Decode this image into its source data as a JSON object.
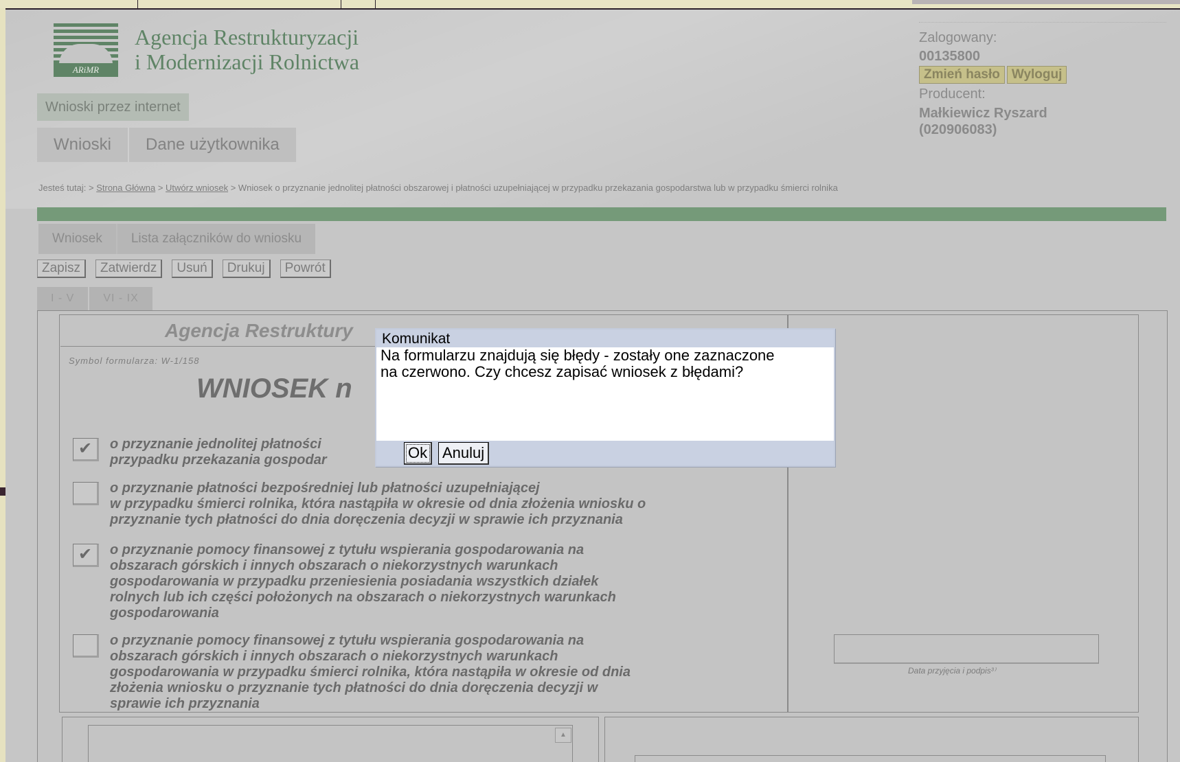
{
  "agency": {
    "line1": "Agencja Restrukturyzacji",
    "line2": "i Modernizacji Rolnictwa",
    "logo_text": "ARiMR"
  },
  "header": {
    "wnioski_button": "Wnioski przez internet",
    "nav": [
      "Wnioski",
      "Dane użytkownika"
    ]
  },
  "user": {
    "logged_label": "Zalogowany:",
    "login": "00135800",
    "change_password": "Zmień hasło",
    "logout": "Wyloguj",
    "producer_label": "Producent:",
    "producer_name": "Małkiewicz Ryszard",
    "producer_id": "(020906083)"
  },
  "breadcrumb": {
    "prefix": "Jesteś tutaj: >",
    "home": "Strona Główna",
    "sep": ">",
    "create": "Utwórz wniosek",
    "current": "> Wniosek o przyznanie jednolitej płatności obszarowej i płatności uzupełniającej w przypadku przekazania gospodarstwa lub w przypadku śmierci rolnika"
  },
  "subtabs": [
    "Wniosek",
    "Lista załączników do wniosku"
  ],
  "toolbar": [
    "Zapisz",
    "Zatwierdz",
    "Usuń",
    "Drukuj",
    "Powrót"
  ],
  "pagetabs": [
    "I - V",
    "VI - IX"
  ],
  "form": {
    "header": "Agencja Restruktury",
    "symbol": "Symbol formularza: W-1/158",
    "title": "WNIOSEK n",
    "options": [
      {
        "checked": "✔",
        "text": "o przyznanie jednolitej płatności\nprzypadku przekazania gospodar"
      },
      {
        "checked": "",
        "text": "o przyznanie płatności bezpośredniej lub płatności uzupełniającej\nw przypadku śmierci rolnika, która nastąpiła w okresie od dnia złożenia wniosku o\nprzyznanie tych płatności do dnia doręczenia decyzji w sprawie ich przyznania"
      },
      {
        "checked": "✔",
        "text": "o przyznanie pomocy finansowej z tytułu wspierania gospodarowania na\nobszarach górskich i innych obszarach o niekorzystnych warunkach\ngospodarowania w przypadku przeniesienia posiadania wszystkich działek\nrolnych lub ich części położonych na obszarach o niekorzystnych warunkach\ngospodarowania"
      },
      {
        "checked": "",
        "text": "o przyznanie pomocy finansowej z tytułu wspierania gospodarowania na\nobszarach górskich i innych obszarach o niekorzystnych warunkach\ngospodarowania w przypadku śmierci rolnika, która nastąpiła w okresie od dnia\nzłożenia wniosku o przyznanie tych płatności do dnia doręczenia decyzji w\nsprawie ich przyznania"
      }
    ],
    "signature_label": "Data przyjęcia i podpis³⁾"
  },
  "dialog": {
    "title": "Komunikat",
    "message": "Na formularzu znajdują się błędy - zostały one zaznaczone\nna czerwono. Czy chcesz zapisać wniosek z błędami?",
    "ok": "Ok",
    "cancel": "Anuluj"
  }
}
